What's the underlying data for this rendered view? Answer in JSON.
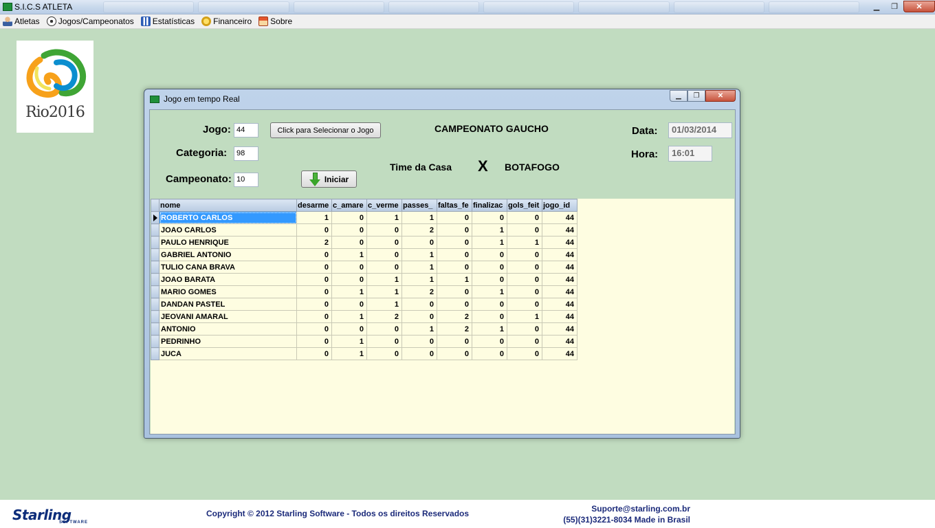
{
  "app": {
    "title": "S.I.C.S ATLETA"
  },
  "window_controls": {
    "minimize": "▁",
    "maximize": "❐",
    "close": "✕"
  },
  "menu": [
    {
      "label": "Atletas",
      "icon": "user-icon"
    },
    {
      "label": "Jogos/Campeonatos",
      "icon": "soccer-ball-icon"
    },
    {
      "label": "Estatísticas",
      "icon": "chart-icon"
    },
    {
      "label": "Financeiro",
      "icon": "coins-icon"
    },
    {
      "label": "Sobre",
      "icon": "about-icon"
    }
  ],
  "logo": {
    "text": "Rio2016"
  },
  "dialog": {
    "title": "Jogo em tempo Real",
    "jogo_label": "Jogo:",
    "jogo_value": "44",
    "categoria_label": "Categoria:",
    "categoria_value": "98",
    "campeonato_label": "Campeonato:",
    "campeonato_value": "10",
    "select_button": "Click para Selecionar o Jogo",
    "start_button": "Iniciar",
    "championship_name": "CAMPEONATO GAUCHO",
    "home_team": "Time da Casa",
    "versus": "X",
    "away_team": "BOTAFOGO",
    "data_label": "Data:",
    "data_value": "01/03/2014",
    "hora_label": "Hora:",
    "hora_value": "16:01"
  },
  "grid": {
    "columns": [
      "nome",
      "desarme",
      "c_amare",
      "c_verme",
      "passes_",
      "faltas_fe",
      "finalizac",
      "gols_feit",
      "jogo_id"
    ],
    "rows": [
      [
        "ROBERTO CARLOS",
        "1",
        "0",
        "1",
        "1",
        "0",
        "0",
        "0",
        "44"
      ],
      [
        "JOAO CARLOS",
        "0",
        "0",
        "0",
        "2",
        "0",
        "1",
        "0",
        "44"
      ],
      [
        "PAULO HENRIQUE",
        "2",
        "0",
        "0",
        "0",
        "0",
        "1",
        "1",
        "44"
      ],
      [
        "GABRIEL ANTONIO",
        "0",
        "1",
        "0",
        "1",
        "0",
        "0",
        "0",
        "44"
      ],
      [
        "TULIO CANA BRAVA",
        "0",
        "0",
        "0",
        "1",
        "0",
        "0",
        "0",
        "44"
      ],
      [
        "JOAO BARATA",
        "0",
        "0",
        "1",
        "1",
        "1",
        "0",
        "0",
        "44"
      ],
      [
        "MARIO GOMES",
        "0",
        "1",
        "1",
        "2",
        "0",
        "1",
        "0",
        "44"
      ],
      [
        "DANDAN PASTEL",
        "0",
        "0",
        "1",
        "0",
        "0",
        "0",
        "0",
        "44"
      ],
      [
        "JEOVANI AMARAL",
        "0",
        "1",
        "2",
        "0",
        "2",
        "0",
        "1",
        "44"
      ],
      [
        "ANTONIO",
        "0",
        "0",
        "0",
        "1",
        "2",
        "1",
        "0",
        "44"
      ],
      [
        "PEDRINHO",
        "0",
        "1",
        "0",
        "0",
        "0",
        "0",
        "0",
        "44"
      ],
      [
        "JUCA",
        "0",
        "1",
        "0",
        "0",
        "0",
        "0",
        "0",
        "44"
      ]
    ],
    "selected_row": 0
  },
  "footer": {
    "brand": "Starling",
    "brand_sub": "SOFTWARE",
    "copyright": "Copyright © 2012 Starling Software - Todos os direitos Reservados",
    "support_email": "Suporte@starling.com.br",
    "support_phone": "(55)(31)3221-8034 Made in Brasil"
  },
  "colors": {
    "background": "#c1dcc0",
    "grid_bg": "#fefde1",
    "selection": "#3399ff",
    "footer_text": "#1b2a7a"
  }
}
